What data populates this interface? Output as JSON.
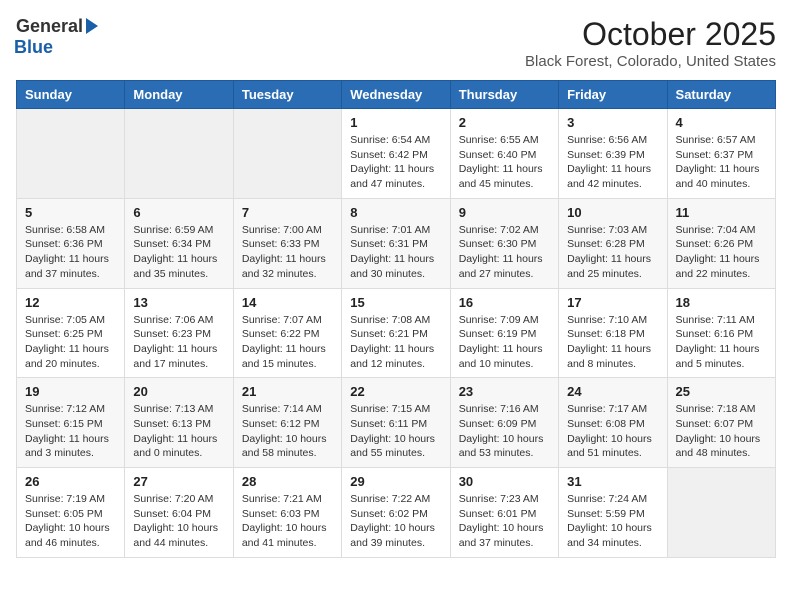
{
  "logo": {
    "general": "General",
    "blue": "Blue"
  },
  "title": "October 2025",
  "subtitle": "Black Forest, Colorado, United States",
  "weekdays": [
    "Sunday",
    "Monday",
    "Tuesday",
    "Wednesday",
    "Thursday",
    "Friday",
    "Saturday"
  ],
  "weeks": [
    [
      {
        "day": "",
        "content": ""
      },
      {
        "day": "",
        "content": ""
      },
      {
        "day": "",
        "content": ""
      },
      {
        "day": "1",
        "content": "Sunrise: 6:54 AM\nSunset: 6:42 PM\nDaylight: 11 hours\nand 47 minutes."
      },
      {
        "day": "2",
        "content": "Sunrise: 6:55 AM\nSunset: 6:40 PM\nDaylight: 11 hours\nand 45 minutes."
      },
      {
        "day": "3",
        "content": "Sunrise: 6:56 AM\nSunset: 6:39 PM\nDaylight: 11 hours\nand 42 minutes."
      },
      {
        "day": "4",
        "content": "Sunrise: 6:57 AM\nSunset: 6:37 PM\nDaylight: 11 hours\nand 40 minutes."
      }
    ],
    [
      {
        "day": "5",
        "content": "Sunrise: 6:58 AM\nSunset: 6:36 PM\nDaylight: 11 hours\nand 37 minutes."
      },
      {
        "day": "6",
        "content": "Sunrise: 6:59 AM\nSunset: 6:34 PM\nDaylight: 11 hours\nand 35 minutes."
      },
      {
        "day": "7",
        "content": "Sunrise: 7:00 AM\nSunset: 6:33 PM\nDaylight: 11 hours\nand 32 minutes."
      },
      {
        "day": "8",
        "content": "Sunrise: 7:01 AM\nSunset: 6:31 PM\nDaylight: 11 hours\nand 30 minutes."
      },
      {
        "day": "9",
        "content": "Sunrise: 7:02 AM\nSunset: 6:30 PM\nDaylight: 11 hours\nand 27 minutes."
      },
      {
        "day": "10",
        "content": "Sunrise: 7:03 AM\nSunset: 6:28 PM\nDaylight: 11 hours\nand 25 minutes."
      },
      {
        "day": "11",
        "content": "Sunrise: 7:04 AM\nSunset: 6:26 PM\nDaylight: 11 hours\nand 22 minutes."
      }
    ],
    [
      {
        "day": "12",
        "content": "Sunrise: 7:05 AM\nSunset: 6:25 PM\nDaylight: 11 hours\nand 20 minutes."
      },
      {
        "day": "13",
        "content": "Sunrise: 7:06 AM\nSunset: 6:23 PM\nDaylight: 11 hours\nand 17 minutes."
      },
      {
        "day": "14",
        "content": "Sunrise: 7:07 AM\nSunset: 6:22 PM\nDaylight: 11 hours\nand 15 minutes."
      },
      {
        "day": "15",
        "content": "Sunrise: 7:08 AM\nSunset: 6:21 PM\nDaylight: 11 hours\nand 12 minutes."
      },
      {
        "day": "16",
        "content": "Sunrise: 7:09 AM\nSunset: 6:19 PM\nDaylight: 11 hours\nand 10 minutes."
      },
      {
        "day": "17",
        "content": "Sunrise: 7:10 AM\nSunset: 6:18 PM\nDaylight: 11 hours\nand 8 minutes."
      },
      {
        "day": "18",
        "content": "Sunrise: 7:11 AM\nSunset: 6:16 PM\nDaylight: 11 hours\nand 5 minutes."
      }
    ],
    [
      {
        "day": "19",
        "content": "Sunrise: 7:12 AM\nSunset: 6:15 PM\nDaylight: 11 hours\nand 3 minutes."
      },
      {
        "day": "20",
        "content": "Sunrise: 7:13 AM\nSunset: 6:13 PM\nDaylight: 11 hours\nand 0 minutes."
      },
      {
        "day": "21",
        "content": "Sunrise: 7:14 AM\nSunset: 6:12 PM\nDaylight: 10 hours\nand 58 minutes."
      },
      {
        "day": "22",
        "content": "Sunrise: 7:15 AM\nSunset: 6:11 PM\nDaylight: 10 hours\nand 55 minutes."
      },
      {
        "day": "23",
        "content": "Sunrise: 7:16 AM\nSunset: 6:09 PM\nDaylight: 10 hours\nand 53 minutes."
      },
      {
        "day": "24",
        "content": "Sunrise: 7:17 AM\nSunset: 6:08 PM\nDaylight: 10 hours\nand 51 minutes."
      },
      {
        "day": "25",
        "content": "Sunrise: 7:18 AM\nSunset: 6:07 PM\nDaylight: 10 hours\nand 48 minutes."
      }
    ],
    [
      {
        "day": "26",
        "content": "Sunrise: 7:19 AM\nSunset: 6:05 PM\nDaylight: 10 hours\nand 46 minutes."
      },
      {
        "day": "27",
        "content": "Sunrise: 7:20 AM\nSunset: 6:04 PM\nDaylight: 10 hours\nand 44 minutes."
      },
      {
        "day": "28",
        "content": "Sunrise: 7:21 AM\nSunset: 6:03 PM\nDaylight: 10 hours\nand 41 minutes."
      },
      {
        "day": "29",
        "content": "Sunrise: 7:22 AM\nSunset: 6:02 PM\nDaylight: 10 hours\nand 39 minutes."
      },
      {
        "day": "30",
        "content": "Sunrise: 7:23 AM\nSunset: 6:01 PM\nDaylight: 10 hours\nand 37 minutes."
      },
      {
        "day": "31",
        "content": "Sunrise: 7:24 AM\nSunset: 5:59 PM\nDaylight: 10 hours\nand 34 minutes."
      },
      {
        "day": "",
        "content": ""
      }
    ]
  ]
}
